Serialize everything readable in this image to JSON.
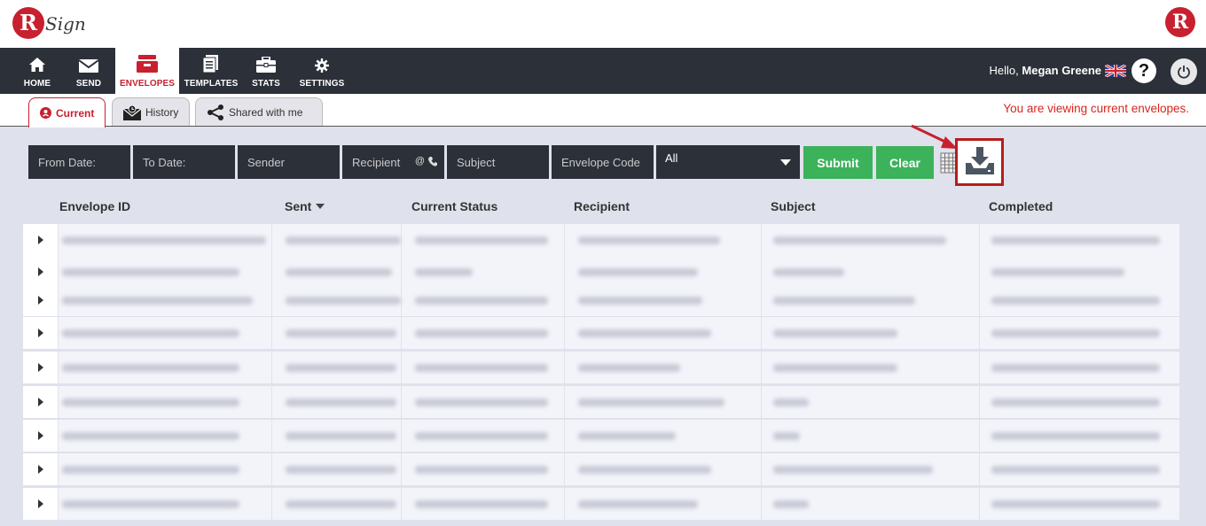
{
  "brand": {
    "logo_letter": "R",
    "logo_text": "Sign",
    "right_logo_letter": "R"
  },
  "nav": {
    "items": [
      {
        "label": "HOME",
        "icon": "home-icon"
      },
      {
        "label": "SEND",
        "icon": "envelope-icon"
      },
      {
        "label": "ENVELOPES",
        "icon": "inbox-icon",
        "active": true
      },
      {
        "label": "TEMPLATES",
        "icon": "document-icon"
      },
      {
        "label": "STATS",
        "icon": "briefcase-icon"
      },
      {
        "label": "SETTINGS",
        "icon": "gear-icon"
      }
    ],
    "greeting": "Hello,",
    "user": "Megan Greene",
    "help_label": "?"
  },
  "tabs": [
    {
      "label": "Current",
      "active": true
    },
    {
      "label": "History"
    },
    {
      "label": "Shared with me"
    }
  ],
  "status_message": "You are viewing current envelopes.",
  "filters": {
    "from_date": "From Date:",
    "to_date": "To Date:",
    "sender": "Sender",
    "recipient": "Recipient",
    "recipient_suffix": "@",
    "subject": "Subject",
    "envelope_code": "Envelope Code",
    "status_selected": "All",
    "submit_label": "Submit",
    "clear_label": "Clear"
  },
  "table": {
    "columns": [
      "Envelope ID",
      "Sent",
      "Current Status",
      "Recipient",
      "Subject",
      "Completed"
    ],
    "sorted_column": "Sent",
    "row_count": 9
  },
  "colors": {
    "brand_red": "#c8202f",
    "nav_dark": "#2c3038",
    "button_green": "#3cb25b",
    "highlight_red": "#b51c1c"
  }
}
